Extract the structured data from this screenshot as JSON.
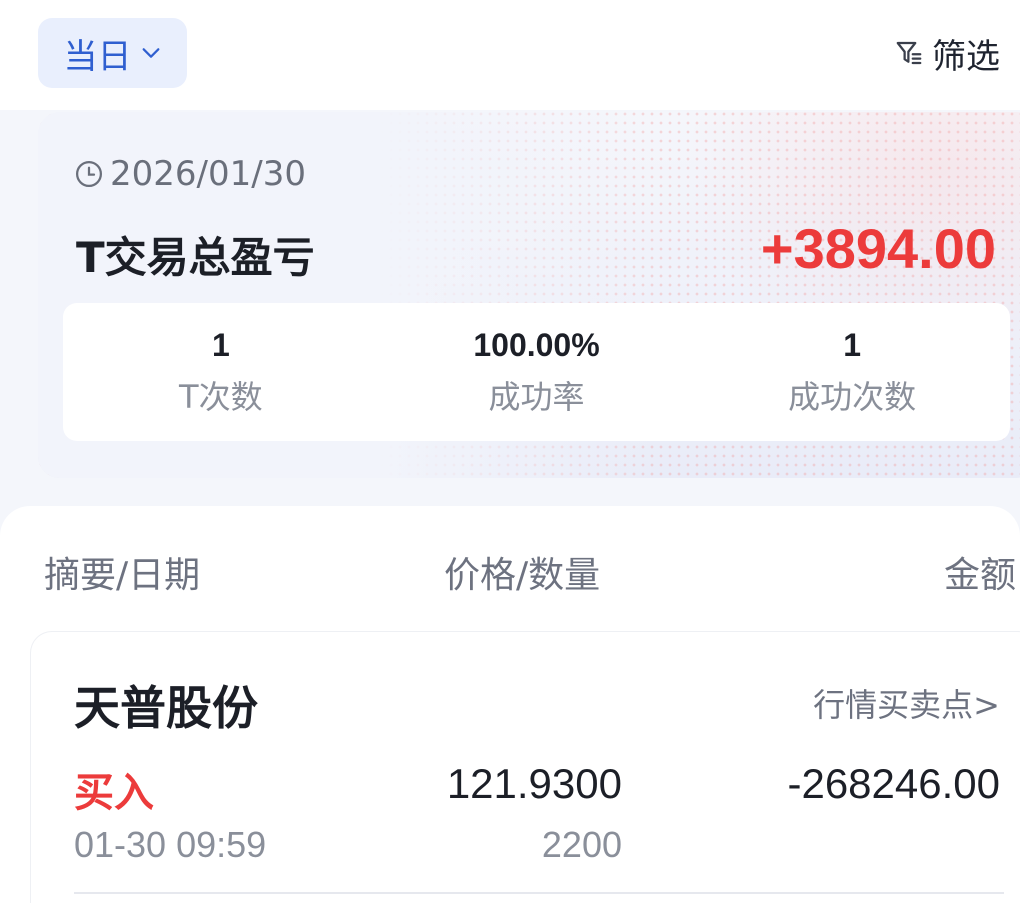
{
  "header": {
    "period_label": "当日",
    "filter_label": "筛选"
  },
  "summary": {
    "date": "2026/01/30",
    "title": "T交易总盈亏",
    "total_pnl": "+3894.00",
    "stats": [
      {
        "value": "1",
        "label": "T次数"
      },
      {
        "value": "100.00%",
        "label": "成功率"
      },
      {
        "value": "1",
        "label": "成功次数"
      }
    ]
  },
  "table": {
    "columns": [
      "摘要/日期",
      "价格/数量",
      "金额"
    ],
    "rows": [
      {
        "stock_name": "天普股份",
        "market_link": "行情买卖点>",
        "type": "买入",
        "time": "01-30 09:59",
        "price": "121.9300",
        "quantity": "2200",
        "amount": "-268246.00"
      }
    ]
  },
  "colors": {
    "accent": "#2f5fd0",
    "profit": "#ec3b3b",
    "buy": "#ec3b3b"
  },
  "icons": {
    "period_chevron": "chevron-down-icon",
    "filter": "filter-icon",
    "clock": "clock-icon"
  }
}
